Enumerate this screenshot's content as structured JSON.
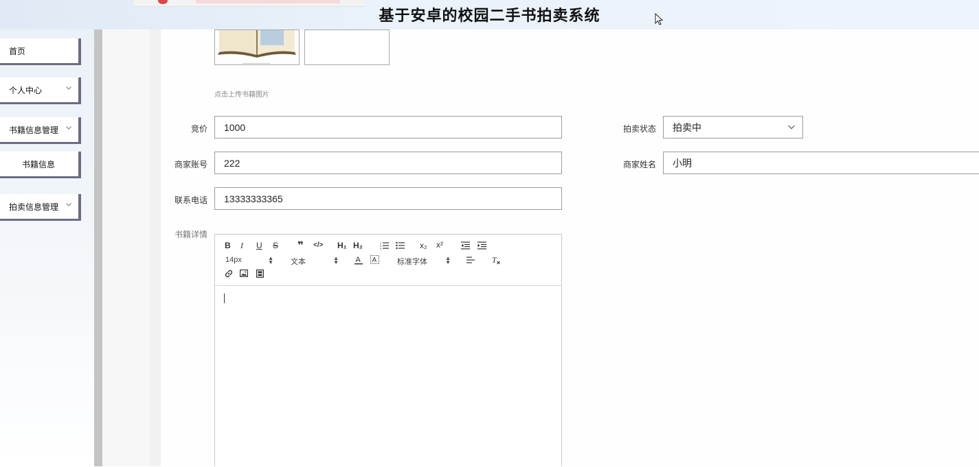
{
  "header": {
    "title": "基于安卓的校园二手书拍卖系统"
  },
  "sidebar": {
    "items": [
      {
        "label": "首页",
        "has_chevron": false
      },
      {
        "label": "个人中心",
        "has_chevron": true
      },
      {
        "label": "书籍信息管理",
        "has_chevron": true
      },
      {
        "label": "书籍信息",
        "has_chevron": false
      },
      {
        "label": "拍卖信息管理",
        "has_chevron": true
      }
    ]
  },
  "form": {
    "upload_hint": "点击上传书籍图片",
    "price_label": "竞价",
    "price_value": "1000",
    "status_label": "拍卖状态",
    "status_value": "拍卖中",
    "account_label": "商家账号",
    "account_value": "222",
    "name_label": "商家姓名",
    "name_value": "小明",
    "phone_label": "联系电话",
    "phone_value": "13333333365",
    "details_label": "书籍详情"
  },
  "editor": {
    "font_size": "14px",
    "block_format": "文本",
    "font_family": "标准字体",
    "subscript_label": "x₂",
    "superscript_label": "x²",
    "h1_label": "H₁",
    "h2_label": "H₂"
  },
  "colors": {
    "sidebar_border": "#6b6b85",
    "header_bg": "#eaf2fa"
  }
}
